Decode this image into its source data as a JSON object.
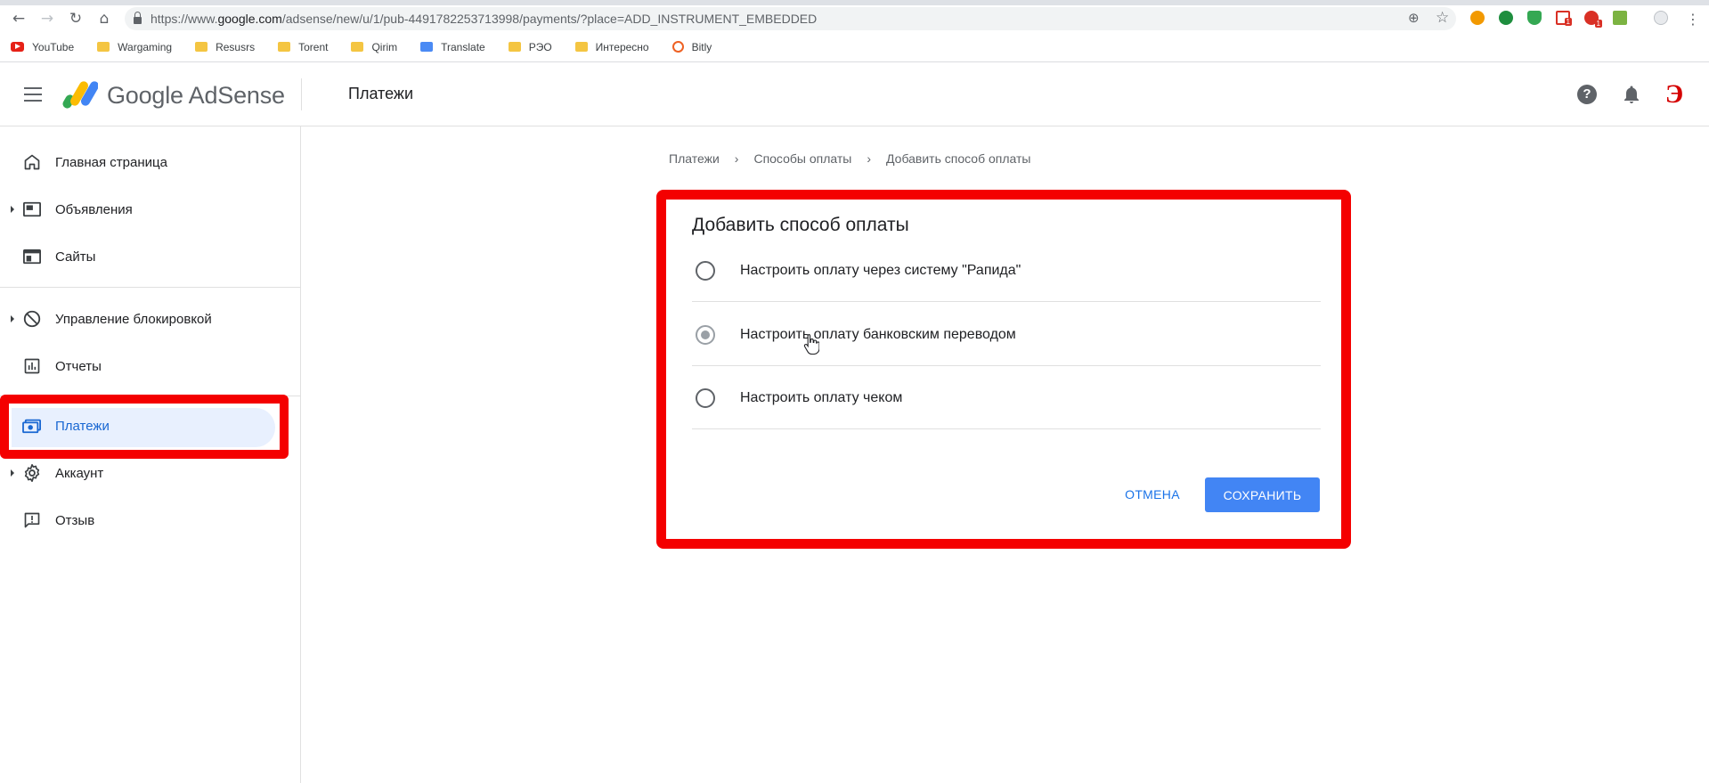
{
  "browser": {
    "url_prefix": "https://www.",
    "url_host": "google.com",
    "url_path": "/adsense/new/u/1/pub-4491782253713998/payments/?place=ADD_INSTRUMENT_EMBEDDED",
    "back_icon": "←",
    "forward_icon": "→",
    "reload_icon": "↻",
    "home_icon": "⌂",
    "zoom_icon": "⊕",
    "star_icon": "☆",
    "menu_icon": "⋮",
    "bookmarks": [
      {
        "label": "YouTube",
        "icon": "youtube-icon"
      },
      {
        "label": "Wargaming",
        "icon": "folder-icon"
      },
      {
        "label": "Resusrs",
        "icon": "folder-icon"
      },
      {
        "label": "Torent",
        "icon": "folder-icon"
      },
      {
        "label": "Qirim",
        "icon": "folder-icon"
      },
      {
        "label": "Translate",
        "icon": "translate-icon"
      },
      {
        "label": "PЭО",
        "icon": "folder-icon"
      },
      {
        "label": "Интересно",
        "icon": "folder-icon"
      },
      {
        "label": "Bitly",
        "icon": "bitly-icon"
      }
    ],
    "extension_badge": "1"
  },
  "header": {
    "logo_text": "Google AdSense",
    "page_title": "Платежи",
    "help_glyph": "?",
    "avatar_letter": "Э"
  },
  "sidebar": {
    "items": [
      {
        "label": "Главная страница",
        "icon": "home-icon"
      },
      {
        "label": "Объявления",
        "icon": "ads-icon"
      },
      {
        "label": "Сайты",
        "icon": "sites-icon"
      },
      {
        "label": "Управление блокировкой",
        "icon": "block-icon"
      },
      {
        "label": "Отчеты",
        "icon": "reports-icon"
      },
      {
        "label": "Платежи",
        "icon": "payments-icon"
      },
      {
        "label": "Аккаунт",
        "icon": "gear-icon"
      },
      {
        "label": "Отзыв",
        "icon": "feedback-icon"
      }
    ],
    "active": "Платежи"
  },
  "breadcrumb": {
    "items": [
      "Платежи",
      "Способы оплаты",
      "Добавить способ оплаты"
    ],
    "separator": "›"
  },
  "dialog": {
    "title": "Добавить способ оплаты",
    "options": [
      {
        "label": "Настроить оплату через систему \"Рапида\"",
        "selected": false
      },
      {
        "label": "Настроить оплату банковским переводом",
        "selected": true
      },
      {
        "label": "Настроить оплату чеком",
        "selected": false
      }
    ],
    "cancel_label": "ОТМЕНА",
    "save_label": "СОХРАНИТЬ"
  },
  "colors": {
    "accent": "#1a73e8",
    "save_button": "#4285f4",
    "highlight": "#f40000",
    "active_bg": "#e8f0fe"
  }
}
